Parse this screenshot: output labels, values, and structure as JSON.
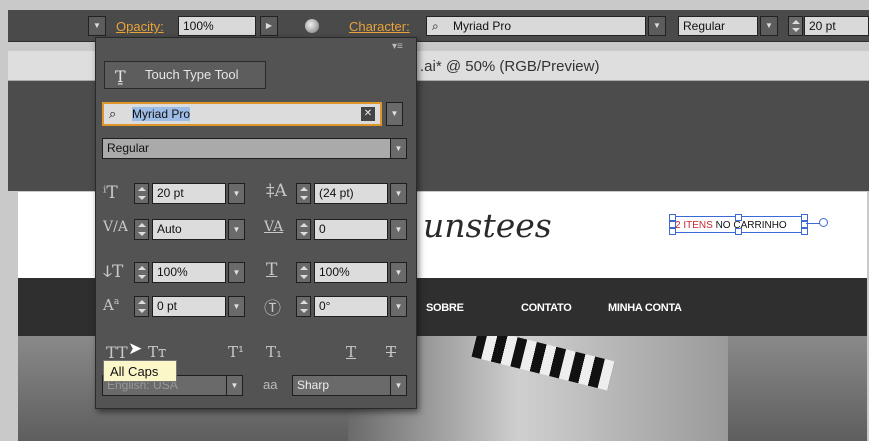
{
  "control_bar": {
    "opacity_label": "Opacity:",
    "opacity_value": "100%",
    "character_label": "Character:",
    "font_value": "Myriad Pro",
    "style_value": "Regular",
    "size_value": "20 pt"
  },
  "document": {
    "tab_title": ".ai* @ 50% (RGB/Preview)"
  },
  "website": {
    "logo_text": "unstees",
    "cart_count": "2 ITENS",
    "cart_text": " NO CARRINHO",
    "nav": [
      "SOBRE",
      "CONTATO",
      "MINHA CONTA"
    ]
  },
  "character_panel": {
    "touch_type_label": "Touch Type Tool",
    "font_family": "Myriad Pro",
    "font_style": "Regular",
    "font_size": "20 pt",
    "leading": "(24 pt)",
    "kerning": "Auto",
    "tracking": "0",
    "vertical_scale": "100%",
    "horizontal_scale": "100%",
    "baseline_shift": "0 pt",
    "rotation": "0°",
    "language": "English: USA",
    "antialiasing": "Sharp",
    "aa_label": "aa"
  },
  "tooltip": "All Caps",
  "colors": {
    "accent_orange": "#e8a33a",
    "panel_bg": "#535353",
    "selection_blue": "#3b6ad6",
    "cart_red": "#c8272f"
  }
}
